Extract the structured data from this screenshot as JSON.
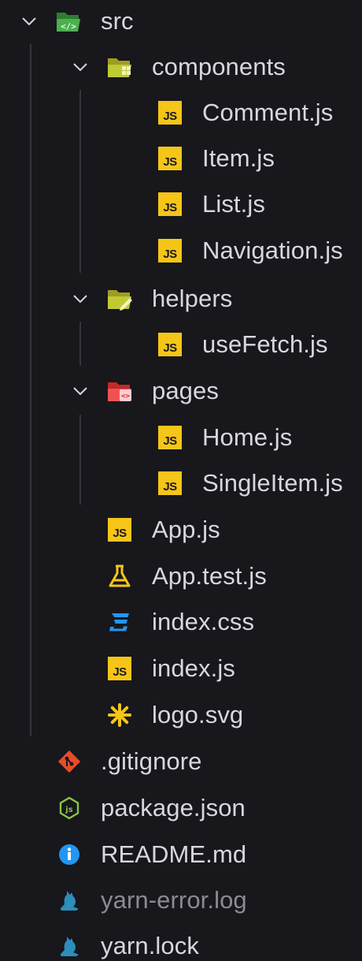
{
  "explorer": {
    "src": {
      "label": "src",
      "expanded": true,
      "icon": "folder-src-open-icon",
      "children": {
        "components": {
          "label": "components",
          "expanded": true,
          "icon": "folder-components-open-icon",
          "files": [
            "Comment.js",
            "Item.js",
            "List.js",
            "Navigation.js"
          ]
        },
        "helpers": {
          "label": "helpers",
          "expanded": true,
          "icon": "folder-helpers-open-icon",
          "files": [
            "useFetch.js"
          ]
        },
        "pages": {
          "label": "pages",
          "expanded": true,
          "icon": "folder-pages-open-icon",
          "files": [
            "Home.js",
            "SingleItem.js"
          ]
        },
        "files": [
          {
            "label": "App.js",
            "icon": "javascript-icon"
          },
          {
            "label": "App.test.js",
            "icon": "test-flask-icon"
          },
          {
            "label": "index.css",
            "icon": "css-icon"
          },
          {
            "label": "index.js",
            "icon": "javascript-icon"
          },
          {
            "label": "logo.svg",
            "icon": "svg-asterisk-icon"
          }
        ]
      }
    },
    "root_files": [
      {
        "label": ".gitignore",
        "icon": "git-icon"
      },
      {
        "label": "package.json",
        "icon": "nodejs-icon"
      },
      {
        "label": "README.md",
        "icon": "info-icon"
      },
      {
        "label": "yarn-error.log",
        "icon": "yarn-icon",
        "dimmed": true
      },
      {
        "label": "yarn.lock",
        "icon": "yarn-icon"
      }
    ]
  },
  "colors": {
    "background": "#17171c",
    "text": "#d7d7de",
    "dimmed_text": "#8b8b92",
    "js_yellow": "#f5c518",
    "css_blue": "#2196f3",
    "git_red": "#e84a2b",
    "node_green": "#8bc34a",
    "info_blue": "#2196f3",
    "yarn_blue": "#2c8ebb",
    "src_green": "#4caf50",
    "helpers_olive": "#c0ca33",
    "pages_red": "#ef5350"
  }
}
